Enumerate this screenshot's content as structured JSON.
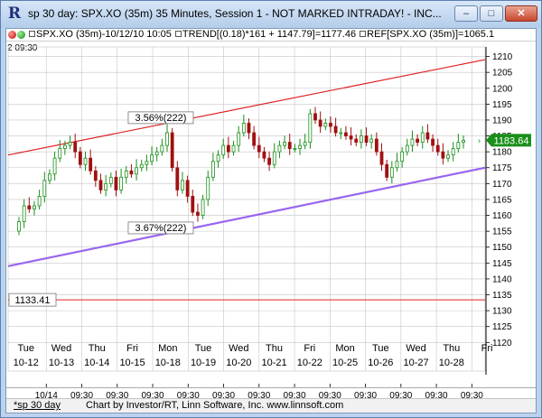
{
  "window": {
    "icon_glyph": "R",
    "title": "sp 30 day: SPX.XO (35m) 35 Minutes, Session 1 - NOT MARKED INTRADAY! - INC...",
    "minimize_glyph": "–",
    "maximize_glyph": "□",
    "close_glyph": "✕"
  },
  "legend": {
    "text_symbol": "SPX.XO (35m)-10/12/10 10:05",
    "text_trend": "TREND[(0.18)*161 + 1147.79]=1177.46",
    "text_ref": "REF[SPX.XO (35m)]=1065.1"
  },
  "period_row": "2   09:30",
  "chart": {
    "last_price_label": "1183.64",
    "ref_line_label": "1133.41",
    "channel_label_upper": "3.56%(222)",
    "channel_label_lower": "3.67%(222)",
    "colors": {
      "upper_line": "#e02020",
      "lower_line": "#9966ee",
      "ref_line": "#e02020",
      "up_candle": "#1a8f1a",
      "down_candle": "#a01010",
      "price_marker": "#1a8f1a",
      "grid": "#c6c6c6"
    }
  },
  "chart_data": {
    "type": "candlestick",
    "ylim": [
      1111,
      1213
    ],
    "y_ticks": [
      1120,
      1125,
      1130,
      1135,
      1140,
      1145,
      1150,
      1155,
      1160,
      1165,
      1170,
      1175,
      1180,
      1185,
      1190,
      1195,
      1200,
      1205,
      1210
    ],
    "last_price": 1183.64,
    "reference_level": 1133.41,
    "upper_channel": {
      "start": 1179,
      "end": 1209,
      "label": "3.56%(222)"
    },
    "lower_channel": {
      "start": 1144,
      "end": 1175,
      "label": "3.67%(222)"
    },
    "days": [
      {
        "dow": "Tue",
        "date": "10-12"
      },
      {
        "dow": "Wed",
        "date": "10-13"
      },
      {
        "dow": "Thu",
        "date": "10-14"
      },
      {
        "dow": "Fri",
        "date": "10-15"
      },
      {
        "dow": "Mon",
        "date": "10-18"
      },
      {
        "dow": "Tue",
        "date": "10-19"
      },
      {
        "dow": "Wed",
        "date": "10-20"
      },
      {
        "dow": "Thu",
        "date": "10-21"
      },
      {
        "dow": "Fri",
        "date": "10-22"
      },
      {
        "dow": "Mon",
        "date": "10-25"
      },
      {
        "dow": "Tue",
        "date": "10-26"
      },
      {
        "dow": "Wed",
        "date": "10-27"
      },
      {
        "dow": "Thu",
        "date": "10-28"
      },
      {
        "dow": "Fri",
        "date": ""
      }
    ],
    "bottom_ticks": [
      "10/14",
      "09:30",
      "09:30",
      "09:30",
      "09:30",
      "09:30",
      "09:30",
      "09:30",
      "09:30",
      "09:30",
      "09:30",
      "09:30",
      "09:30"
    ],
    "closes": [
      1158,
      1163,
      1162,
      1163,
      1166,
      1171,
      1173,
      1178,
      1181,
      1182,
      1183,
      1180,
      1176,
      1178,
      1174,
      1171,
      1168,
      1170,
      1172,
      1168,
      1172,
      1174,
      1173,
      1175,
      1176,
      1177,
      1179,
      1180,
      1182,
      1186,
      1175,
      1168,
      1171,
      1166,
      1161,
      1160,
      1165,
      1172,
      1177,
      1179,
      1182,
      1180,
      1182,
      1186,
      1189,
      1186,
      1182,
      1180,
      1178,
      1176,
      1180,
      1182,
      1183,
      1181,
      1181,
      1182,
      1183,
      1192,
      1190,
      1188,
      1189,
      1188,
      1186,
      1186,
      1185,
      1184,
      1183,
      1185,
      1183,
      1184,
      1180,
      1176,
      1172,
      1175,
      1177,
      1180,
      1182,
      1184,
      1183,
      1186,
      1184,
      1182,
      1180,
      1178,
      1179,
      1181,
      1183,
      1183.64
    ]
  },
  "status_bar": {
    "tab_label": "*sp 30 day",
    "credit": "Chart by Investor/RT, Linn Software, Inc. www.linnsoft.com"
  }
}
